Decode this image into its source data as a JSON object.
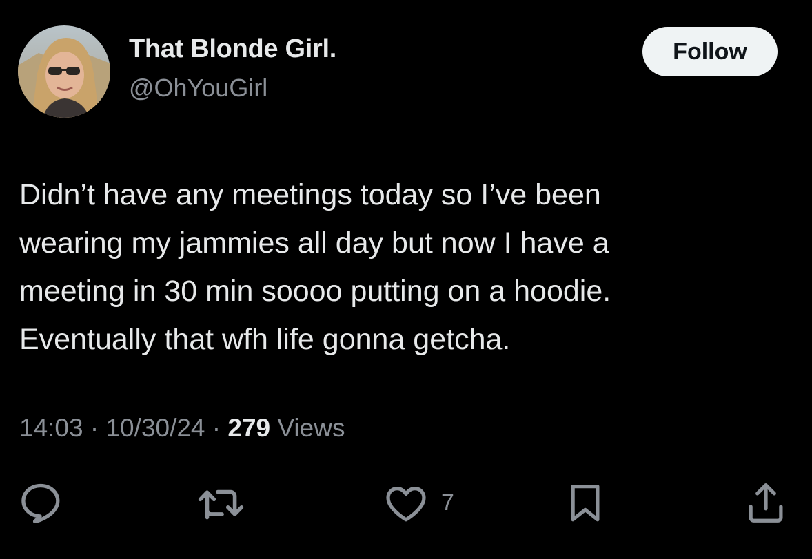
{
  "user": {
    "display_name": "That Blonde Girl.",
    "handle": "@OhYouGirl"
  },
  "follow_label": "Follow",
  "tweet": {
    "lines": [
      "Didn’t have any meetings today so I’ve been",
      "wearing my jammies all day but now I have a",
      "meeting in 30 min soooo putting on a hoodie.",
      "Eventually that wfh life gonna getcha."
    ]
  },
  "meta": {
    "time": "14:03",
    "separator": "·",
    "date": "10/30/24",
    "views_count": "279",
    "views_label": "Views"
  },
  "actions": {
    "reply_icon": "reply-icon",
    "retweet_icon": "retweet-icon",
    "like_icon": "heart-icon",
    "like_count": "7",
    "bookmark_icon": "bookmark-icon",
    "share_icon": "share-icon"
  },
  "colors": {
    "background": "#000000",
    "primary_text": "#e7e9ea",
    "secondary_text": "#8b9097",
    "follow_bg": "#eff3f4"
  }
}
